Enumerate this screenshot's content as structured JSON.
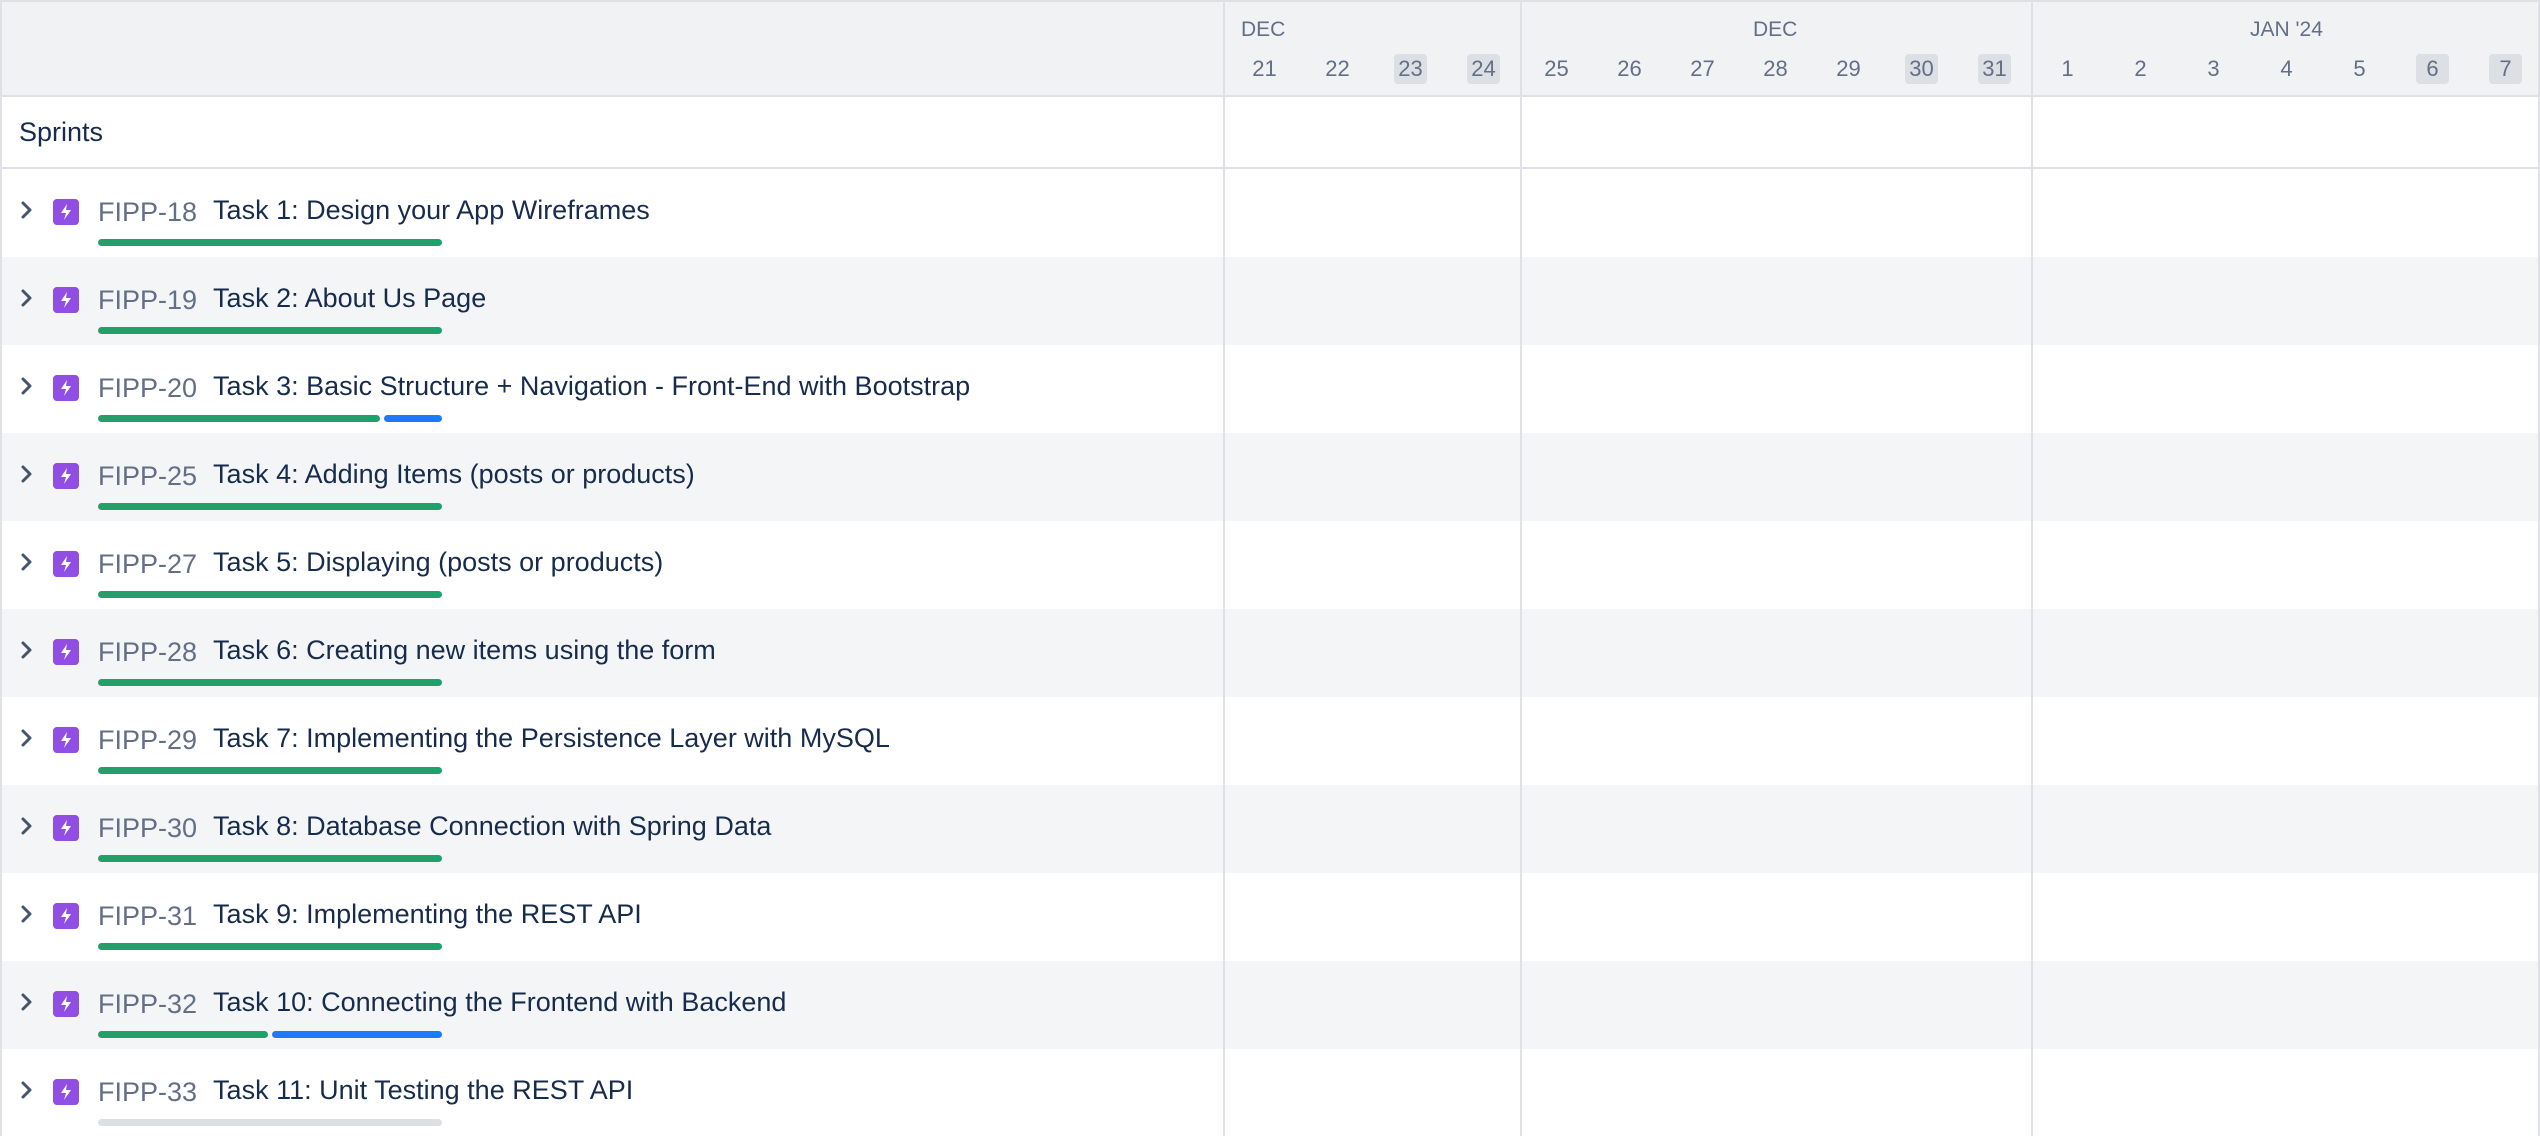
{
  "sidebar": {
    "sprints_label": "Sprints"
  },
  "timeline": {
    "months": [
      {
        "label": "DEC"
      },
      {
        "label": "DEC"
      },
      {
        "label": "JAN '24"
      }
    ],
    "days": [
      {
        "label": "21",
        "weekend": false
      },
      {
        "label": "22",
        "weekend": false
      },
      {
        "label": "23",
        "weekend": true
      },
      {
        "label": "24",
        "weekend": true
      },
      {
        "label": "25",
        "weekend": false
      },
      {
        "label": "26",
        "weekend": false
      },
      {
        "label": "27",
        "weekend": false
      },
      {
        "label": "28",
        "weekend": false
      },
      {
        "label": "29",
        "weekend": false
      },
      {
        "label": "30",
        "weekend": true
      },
      {
        "label": "31",
        "weekend": true
      },
      {
        "label": "1",
        "weekend": false
      },
      {
        "label": "2",
        "weekend": false
      },
      {
        "label": "3",
        "weekend": false
      },
      {
        "label": "4",
        "weekend": false
      },
      {
        "label": "5",
        "weekend": false
      },
      {
        "label": "6",
        "weekend": true
      },
      {
        "label": "7",
        "weekend": true
      }
    ]
  },
  "tasks": [
    {
      "key": "FIPP-18",
      "title": "Task 1: Design your App Wireframes",
      "progress": {
        "done": 1.0,
        "in_progress": 0.0
      }
    },
    {
      "key": "FIPP-19",
      "title": "Task 2: About Us Page",
      "progress": {
        "done": 1.0,
        "in_progress": 0.0
      }
    },
    {
      "key": "FIPP-20",
      "title": "Task 3: Basic Structure + Navigation - Front-End with Bootstrap",
      "progress": {
        "done": 0.83,
        "in_progress": 0.17
      }
    },
    {
      "key": "FIPP-25",
      "title": "Task 4: Adding Items (posts or products)",
      "progress": {
        "done": 1.0,
        "in_progress": 0.0
      }
    },
    {
      "key": "FIPP-27",
      "title": "Task 5: Displaying (posts or products)",
      "progress": {
        "done": 1.0,
        "in_progress": 0.0
      }
    },
    {
      "key": "FIPP-28",
      "title": "Task 6: Creating new items using the form",
      "progress": {
        "done": 1.0,
        "in_progress": 0.0
      }
    },
    {
      "key": "FIPP-29",
      "title": "Task 7: Implementing the Persistence Layer with MySQL",
      "progress": {
        "done": 1.0,
        "in_progress": 0.0
      }
    },
    {
      "key": "FIPP-30",
      "title": "Task 8: Database Connection with Spring Data",
      "progress": {
        "done": 1.0,
        "in_progress": 0.0
      }
    },
    {
      "key": "FIPP-31",
      "title": "Task 9: Implementing the REST API",
      "progress": {
        "done": 1.0,
        "in_progress": 0.0
      }
    },
    {
      "key": "FIPP-32",
      "title": "Task 10: Connecting the Frontend with Backend",
      "progress": {
        "done": 0.5,
        "in_progress": 0.5
      }
    },
    {
      "key": "FIPP-33",
      "title": "Task 11: Unit Testing the REST API",
      "progress": {
        "done": 0.0,
        "in_progress": 0.0
      }
    }
  ],
  "colors": {
    "done": "#22a06b",
    "in_progress": "#1d7afc",
    "todo": "#dcdfe4",
    "epic_icon": "#904ee2"
  },
  "icons": {
    "expand": "chevron-right-icon",
    "issue_type": "lightning-bolt-icon"
  }
}
